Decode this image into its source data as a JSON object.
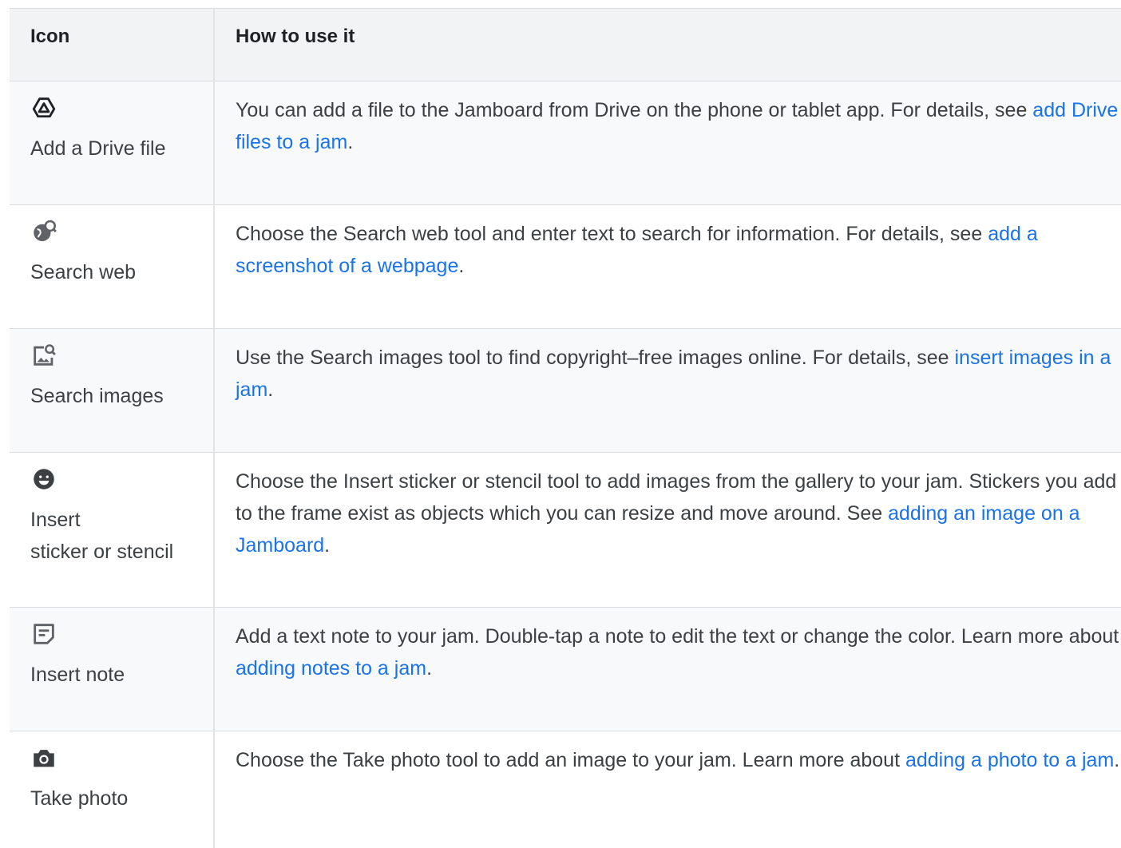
{
  "table": {
    "headers": {
      "icon": "Icon",
      "how": "How to use it"
    },
    "rows": [
      {
        "label": "Add a Drive file",
        "icon": "drive-icon",
        "text_before": "You can add a file to the Jamboard from Drive on the phone or tablet app.  For details, see ",
        "link": "add Drive files to a jam",
        "text_after": "."
      },
      {
        "label": "Search web",
        "icon": "search-web-icon",
        "text_before": "Choose the Search web tool and enter text to search for information. For details, see ",
        "link": "add a screenshot of a webpage",
        "text_after": "."
      },
      {
        "label": "Search images",
        "icon": "search-images-icon",
        "text_before": "Use the Search images tool to find copyright–free images online. For details, see ",
        "link": "insert images in a jam",
        "text_after": "."
      },
      {
        "label": "Insert\nsticker or stencil",
        "icon": "sticker-icon",
        "text_before": "Choose the Insert sticker or stencil tool to add images from the gallery to your jam. Stickers you add to the frame exist as objects which you can resize and move around. See ",
        "link": "adding an image on a Jamboard",
        "text_after": "."
      },
      {
        "label": "Insert note",
        "icon": "note-icon",
        "text_before": "Add a text note to your jam. Double-tap a note to edit the text or change the color. Learn more about ",
        "link": "adding notes to a jam",
        "text_after": "."
      },
      {
        "label": "Take photo",
        "icon": "camera-icon",
        "text_before": "Choose the Take photo tool to add an image to your jam. Learn more about ",
        "link": "adding a photo to a jam",
        "text_after": "."
      }
    ]
  },
  "colors": {
    "header_bg": "#f1f3f4",
    "shaded_row_bg": "#f8f9fa",
    "link": "#1a73e8",
    "text": "#3c4043"
  }
}
